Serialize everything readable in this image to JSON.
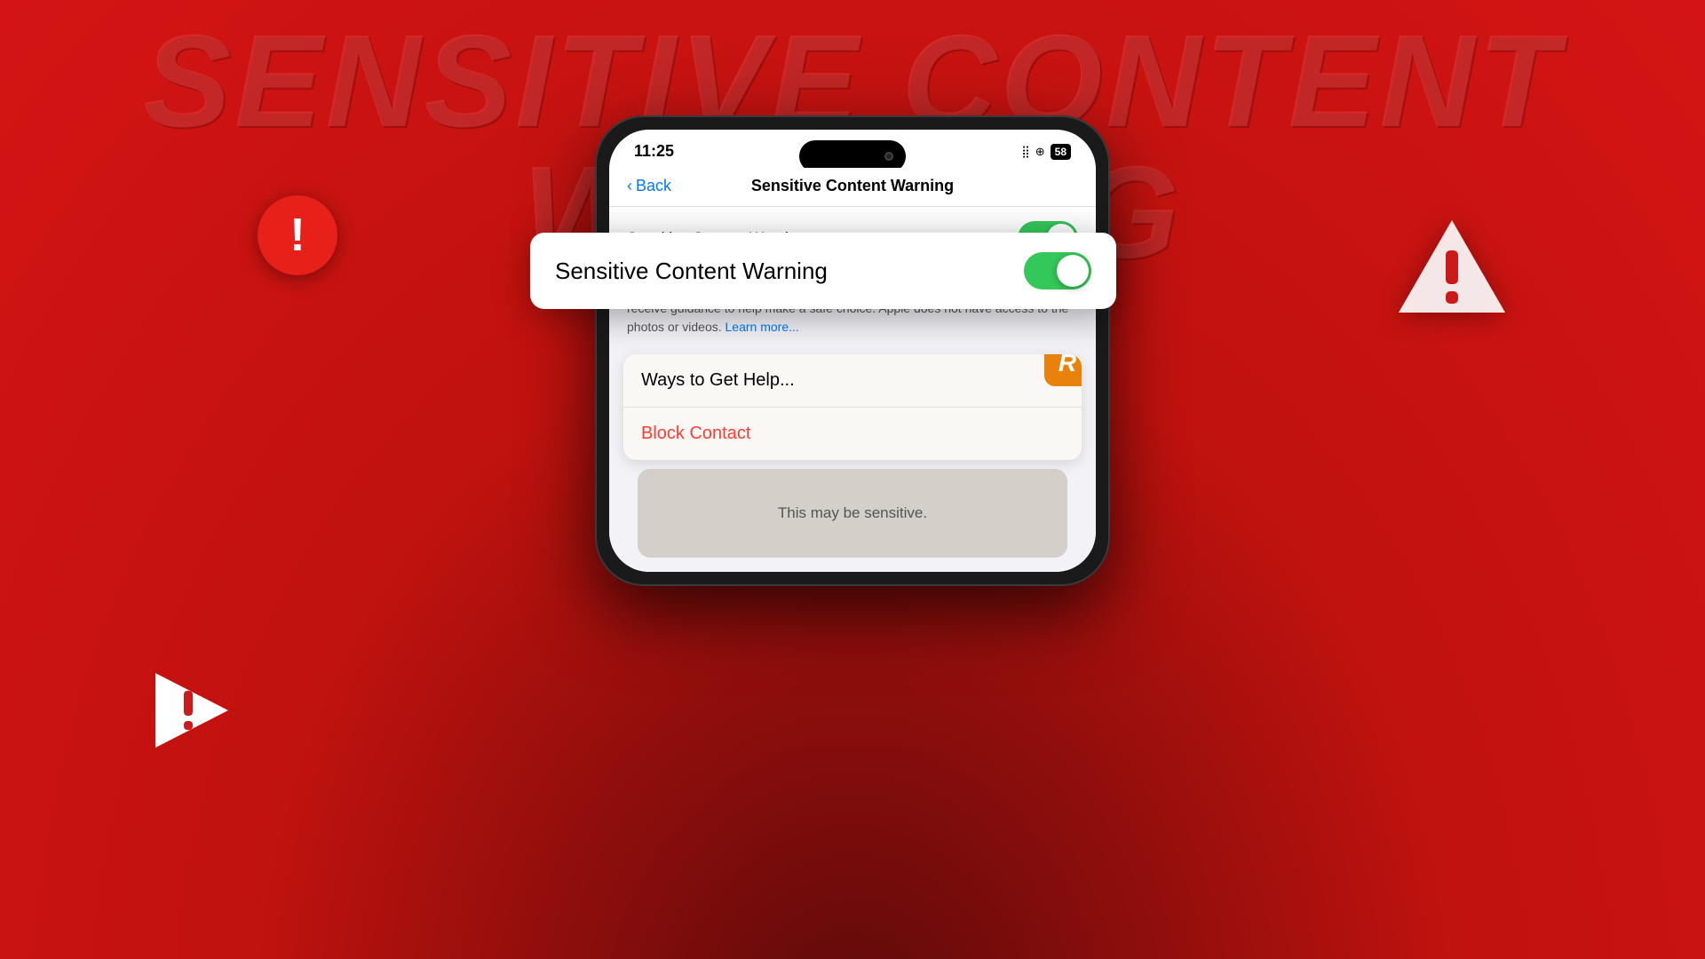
{
  "page": {
    "title": "Sensitive Content Warning"
  },
  "background": {
    "color": "#c0120e"
  },
  "main_title": {
    "text": "SENSITIVE CONTENT WARNING",
    "color": "rgba(220,60,60,0.55)"
  },
  "icons": {
    "circle_exclaim": "!",
    "triangle_warning": "triangle-warning",
    "play_triangle": "play-warning"
  },
  "phone": {
    "status_bar": {
      "time": "11:25",
      "battery": "58",
      "signal_icons": "⣿ ⊕"
    },
    "nav": {
      "back_label": "Back",
      "title": "Sensitive Content Warning"
    },
    "scw_card": {
      "label": "Sensitive Content Warning",
      "toggle_on": true
    },
    "description": {
      "text": "Detect nude photos and videos before they are viewed on your iPhone, and receive guidance to help make a safe choice. Apple does not have access to the photos or videos.",
      "learn_more": "Learn more..."
    },
    "popup": {
      "app_icon_letter": "R",
      "menu_items": [
        {
          "label": "Ways to Get Help...",
          "color": "black"
        },
        {
          "label": "Block Contact",
          "color": "red"
        }
      ]
    },
    "sensitive_area": {
      "text": "This may be sensitive."
    }
  },
  "floating_card": {
    "label": "Sensitive Content Warning",
    "toggle_on": true
  }
}
